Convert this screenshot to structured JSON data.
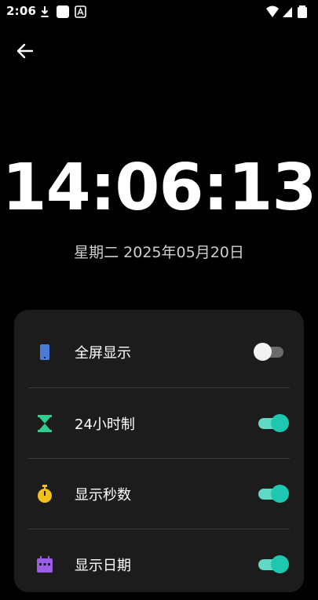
{
  "status_bar": {
    "time": "2:06",
    "left_icons": [
      "download-icon",
      "app-square-icon",
      "notification-a-icon"
    ],
    "right_icons": [
      "wifi-icon",
      "cell-signal-icon",
      "battery-icon"
    ]
  },
  "app_bar": {
    "back_icon": "arrow-left-icon"
  },
  "clock": {
    "time": "14:06:13",
    "date": "星期二 2025年05月20日"
  },
  "settings": {
    "items": [
      {
        "label": "全屏显示",
        "icon": "phone-fullscreen-icon",
        "icon_color": "#4a7bd6",
        "enabled": false
      },
      {
        "label": "24小时制",
        "icon": "hourglass-icon",
        "icon_color": "#2ecf8e",
        "enabled": true
      },
      {
        "label": "显示秒数",
        "icon": "stopwatch-icon",
        "icon_color": "#f2c01e",
        "enabled": true
      },
      {
        "label": "显示日期",
        "icon": "calendar-icon",
        "icon_color": "#9b5de5",
        "enabled": true
      }
    ]
  },
  "colors": {
    "background": "#000000",
    "card": "#1c1c1c",
    "toggle_on": "#1ec8b0",
    "toggle_off_track": "#6b6b6b"
  }
}
